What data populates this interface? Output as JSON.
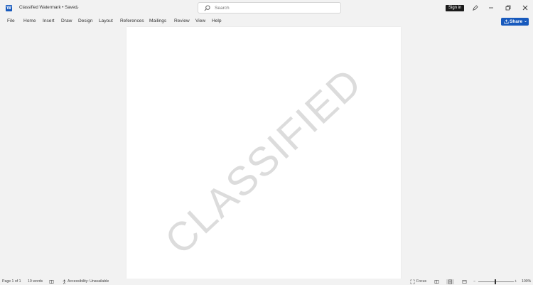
{
  "window": {
    "doc_title": "Classified Watermark • Saved",
    "search_placeholder": "Search",
    "sign_in_label": "Sign in",
    "app_icon_letter": "W",
    "chevron": "⌄"
  },
  "menu": {
    "items": [
      "File",
      "Home",
      "Insert",
      "Draw",
      "Design",
      "Layout",
      "References",
      "Mailings",
      "Review",
      "View",
      "Help"
    ],
    "share_label": "Share"
  },
  "document": {
    "watermark_text": "CLASSIFIED"
  },
  "status": {
    "page": "Page 1 of 1",
    "words": "10 words",
    "accessibility": "Accessibility: Unavailable",
    "focus": "Focus",
    "zoom_minus": "−",
    "zoom_plus": "+",
    "zoom": "100%"
  },
  "colors": {
    "accent": "#185abd",
    "watermark": "#dcdcdc"
  }
}
